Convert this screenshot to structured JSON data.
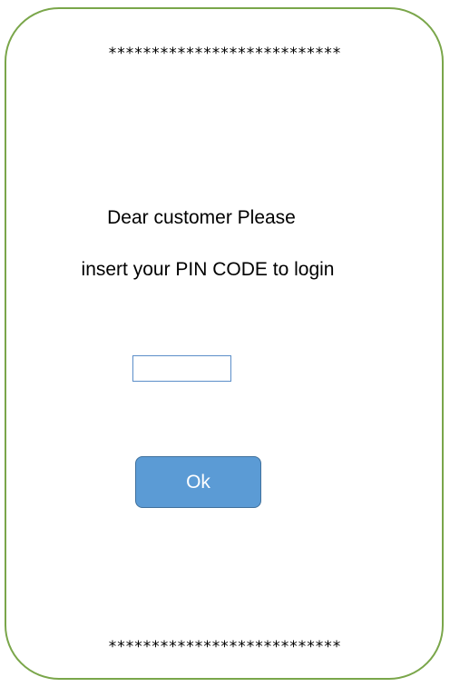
{
  "header": {
    "stars": "***************************"
  },
  "message": {
    "line1": "Dear customer Please",
    "line2": "insert your PIN CODE to login"
  },
  "pin": {
    "value": ""
  },
  "actions": {
    "ok_label": "Ok"
  },
  "footer": {
    "stars": "***************************"
  },
  "colors": {
    "frame_border": "#7aa64a",
    "button_fill": "#5b9bd5",
    "button_border": "#41719c",
    "input_border": "#5b8ec9"
  }
}
